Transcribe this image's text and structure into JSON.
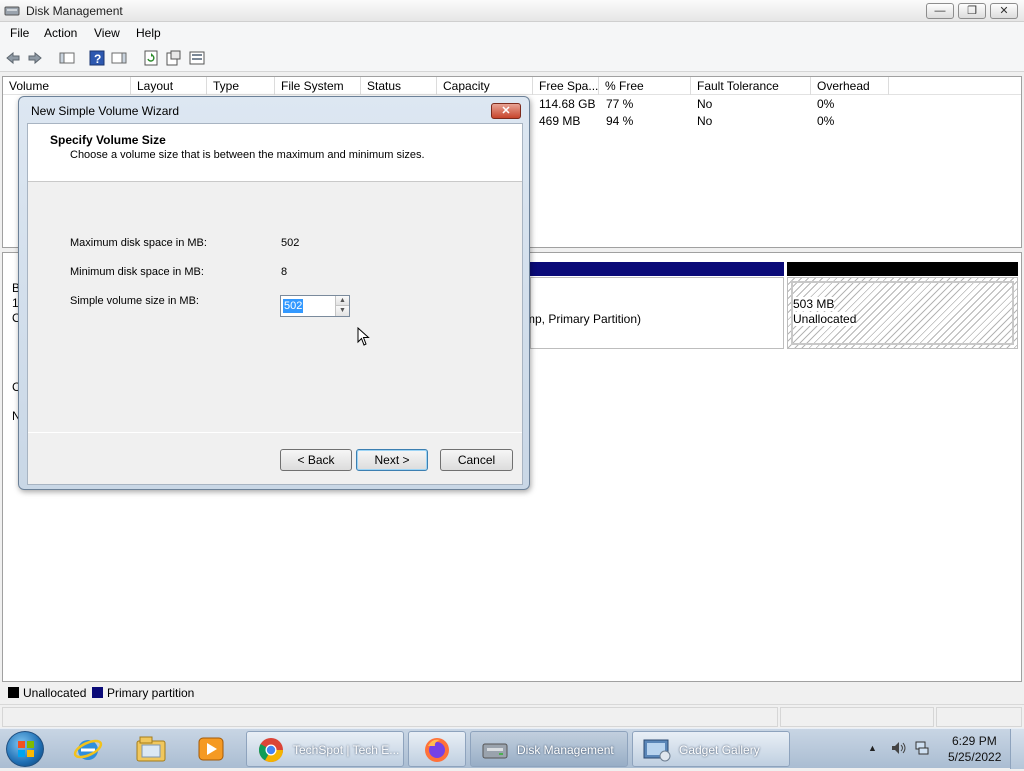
{
  "window": {
    "title": "Disk Management",
    "controls": {
      "minimize": "—",
      "restore": "❐",
      "close": "✕"
    }
  },
  "menu": [
    "File",
    "Action",
    "View",
    "Help"
  ],
  "toolbar_icons": [
    "back-icon",
    "forward-icon",
    "show-hide-console-icon",
    "help-icon",
    "properties-icon",
    "refresh-icon",
    "export-icon",
    "settings-icon"
  ],
  "volume_list": {
    "columns": [
      "Volume",
      "Layout",
      "Type",
      "File System",
      "Status",
      "Capacity",
      "Free Spa...",
      "% Free",
      "Fault Tolerance",
      "Overhead"
    ],
    "rows": [
      {
        "free_space": "114.68 GB",
        "percent_free": "77 %",
        "fault_tolerance": "No",
        "overhead": "0%"
      },
      {
        "free_space": "469 MB",
        "percent_free": "94 %",
        "fault_tolerance": "No",
        "overhead": "0%"
      }
    ]
  },
  "disk_view": {
    "left_fragments": [
      "B",
      "1.",
      "O",
      "C",
      "N"
    ],
    "partition_text": "mp, Primary Partition)",
    "unallocated": {
      "size": "503 MB",
      "label": "Unallocated"
    }
  },
  "legend": {
    "items": [
      {
        "label": "Unallocated",
        "color": "#000000"
      },
      {
        "label": "Primary partition",
        "color": "#0a0a78"
      }
    ]
  },
  "dialog": {
    "title": "New Simple Volume Wizard",
    "close_glyph": "✕",
    "heading": "Specify Volume Size",
    "subheading": "Choose a volume size that is between the maximum and minimum sizes.",
    "max_label": "Maximum disk space in MB:",
    "max_value": "502",
    "min_label": "Minimum disk space in MB:",
    "min_value": "8",
    "size_label": "Simple volume size in MB:",
    "size_value": "502",
    "buttons": {
      "back": "< Back",
      "next": "Next >",
      "cancel": "Cancel"
    }
  },
  "taskbar": {
    "pinned": [
      "internet-explorer-icon",
      "windows-explorer-icon",
      "media-player-icon"
    ],
    "tasks": [
      {
        "label": "TechSpot | Tech E...",
        "icon": "chrome-icon"
      },
      {
        "label": "",
        "icon": "firefox-icon"
      },
      {
        "label": "Disk Management",
        "icon": "disk-management-icon"
      },
      {
        "label": "Gadget Gallery",
        "icon": "gadget-gallery-icon"
      }
    ],
    "clock": {
      "time": "6:29 PM",
      "date": "5/25/2022"
    }
  },
  "colors": {
    "primary_partition": "#0a0a78",
    "unallocated": "#000000",
    "selection": "#3399ff"
  }
}
